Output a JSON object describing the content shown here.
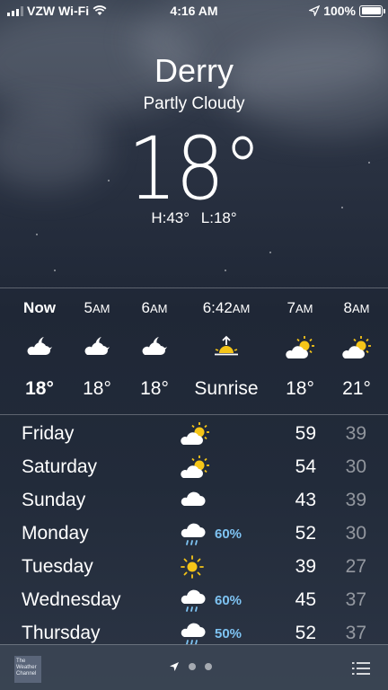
{
  "status_bar": {
    "carrier": "VZW Wi-Fi",
    "time": "4:16 AM",
    "battery": "100%",
    "icons": [
      "signal-icon",
      "wifi-icon",
      "location-arrow-icon",
      "battery-icon"
    ]
  },
  "header": {
    "city": "Derry",
    "condition": "Partly Cloudy",
    "temperature": "18°",
    "high": "H:43°",
    "low": "L:18°"
  },
  "hourly": [
    {
      "time": "Now",
      "suffix": "",
      "icon": "moon-cloud-icon",
      "temp": "18°"
    },
    {
      "time": "5",
      "suffix": "AM",
      "icon": "moon-cloud-icon",
      "temp": "18°"
    },
    {
      "time": "6",
      "suffix": "AM",
      "icon": "moon-cloud-icon",
      "temp": "18°"
    },
    {
      "time": "6:42",
      "suffix": "AM",
      "icon": "sunrise-icon",
      "temp": "Sunrise"
    },
    {
      "time": "7",
      "suffix": "AM",
      "icon": "sun-cloud-icon",
      "temp": "18°"
    },
    {
      "time": "8",
      "suffix": "AM",
      "icon": "sun-cloud-icon",
      "temp": "21°"
    }
  ],
  "daily": [
    {
      "day": "Friday",
      "icon": "sun-cloud-icon",
      "precip": "",
      "high": "59",
      "low": "39"
    },
    {
      "day": "Saturday",
      "icon": "sun-cloud-icon",
      "precip": "",
      "high": "54",
      "low": "30"
    },
    {
      "day": "Sunday",
      "icon": "cloud-icon",
      "precip": "",
      "high": "43",
      "low": "39"
    },
    {
      "day": "Monday",
      "icon": "rain-cloud-icon",
      "precip": "60%",
      "high": "52",
      "low": "30"
    },
    {
      "day": "Tuesday",
      "icon": "sun-icon",
      "precip": "",
      "high": "39",
      "low": "27"
    },
    {
      "day": "Wednesday",
      "icon": "rain-cloud-icon",
      "precip": "60%",
      "high": "45",
      "low": "37"
    },
    {
      "day": "Thursday",
      "icon": "rain-cloud-icon",
      "precip": "50%",
      "high": "52",
      "low": "37"
    }
  ],
  "bottom_bar": {
    "logo_text": "The Weather Channel",
    "icons": [
      "weather-channel-logo-icon",
      "location-arrow-icon",
      "page-dot-icon",
      "list-icon"
    ]
  },
  "colors": {
    "precip": "#7ec3f2",
    "sun": "#f5c518",
    "low_temp": "rgba(255,255,255,0.5)"
  }
}
